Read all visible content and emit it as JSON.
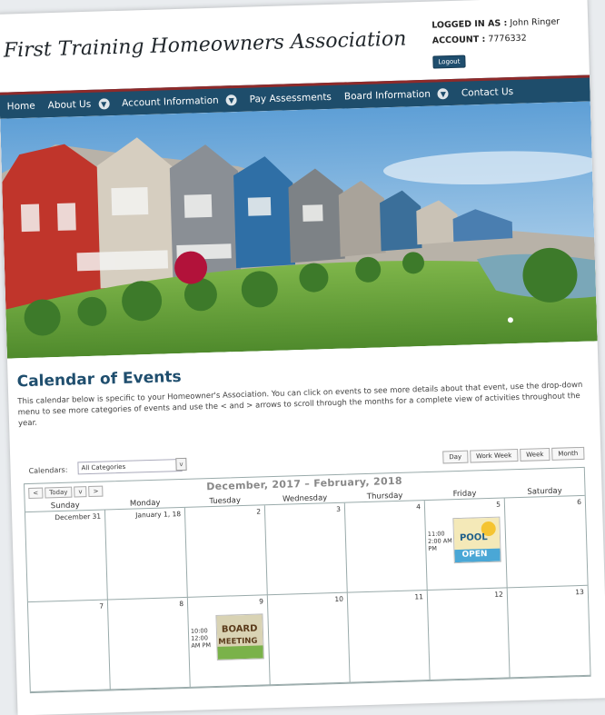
{
  "header": {
    "site_title": "First Training Homeowners Association",
    "logged_label": "LOGGED IN AS :",
    "user": "John Ringer",
    "account_label": "ACCOUNT :",
    "account_no": "7776332",
    "logout": "Logout"
  },
  "nav": {
    "items": [
      {
        "label": "Home",
        "dropdown": false
      },
      {
        "label": "About Us",
        "dropdown": true
      },
      {
        "label": "Account Information",
        "dropdown": true
      },
      {
        "label": "Pay Assessments",
        "dropdown": false
      },
      {
        "label": "Board Information",
        "dropdown": true
      },
      {
        "label": "Contact Us",
        "dropdown": false
      }
    ]
  },
  "calendar": {
    "title": "Calendar of Events",
    "description": "This calendar below is specific to your Homeowner's Association. You can click on events to see more details about that event, use the drop-down menu to see more categories of events and use the < and > arrows to scroll through the months for a complete view of activities throughout the year.",
    "select_label": "Calendars:",
    "select_value": "All Categories",
    "views": [
      "Day",
      "Work Week",
      "Week",
      "Month"
    ],
    "today": "Today",
    "prev": "<",
    "next": ">",
    "dropdown": "v",
    "range": "December, 2017 – February, 2018",
    "days": [
      "Sunday",
      "Monday",
      "Tuesday",
      "Wednesday",
      "Thursday",
      "Friday",
      "Saturday"
    ],
    "week1": [
      "December 31",
      "January 1, 18",
      "2",
      "3",
      "4",
      "5",
      "6"
    ],
    "week2": [
      "7",
      "8",
      "9",
      "10",
      "11",
      "12",
      "13"
    ],
    "events": {
      "pool": {
        "time": "11:00 2:00 AM PM",
        "line1": "POOL",
        "line2": "OPEN"
      },
      "board": {
        "time": "10:00 12:00 AM PM",
        "line1": "BOARD",
        "line2": "MEETING"
      }
    }
  }
}
